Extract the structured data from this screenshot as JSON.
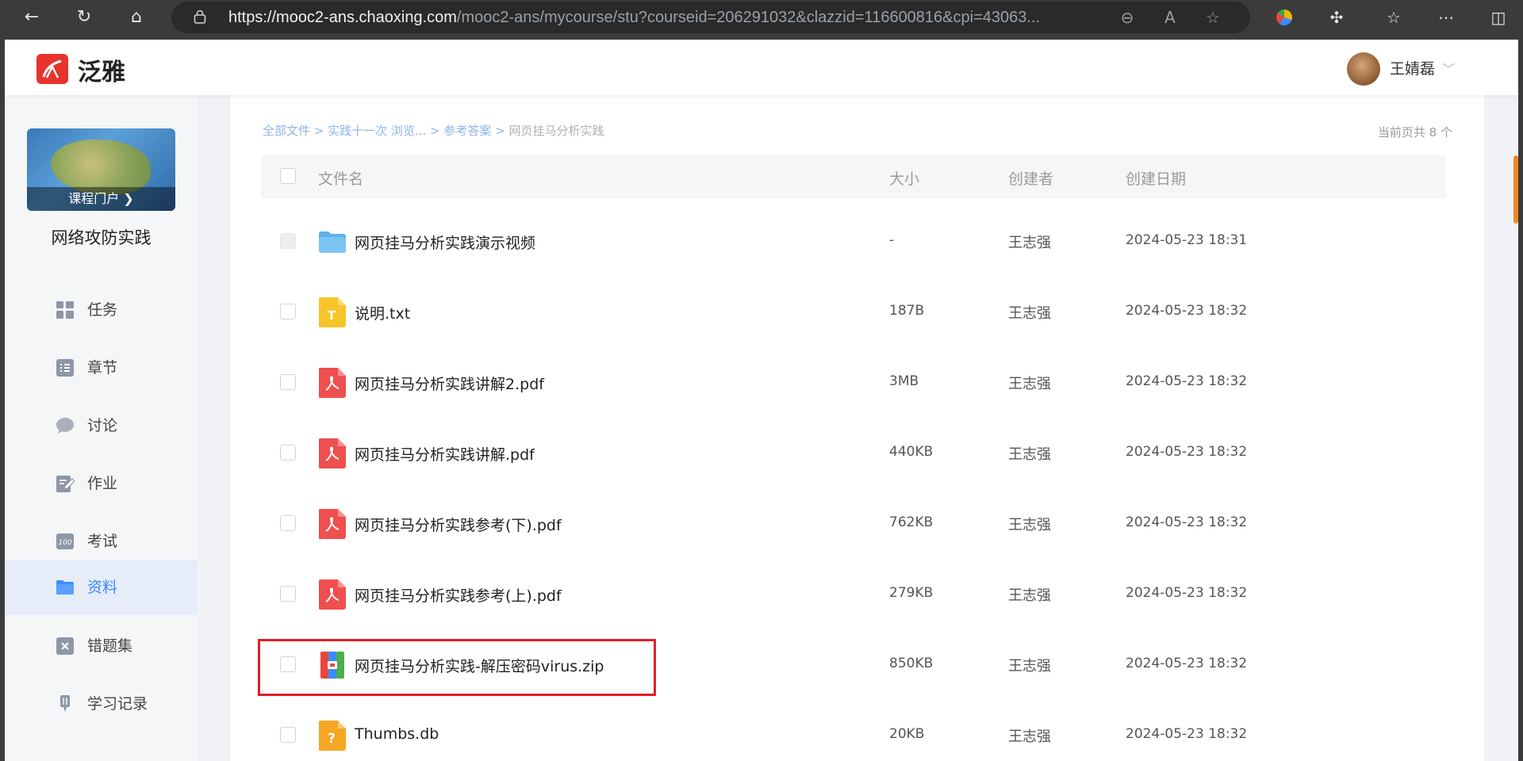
{
  "browser": {
    "url_host": "https://mooc2-ans.chaoxing.com",
    "url_path": "/mooc2-ans/mycourse/stu?courseid=206291032&clazzid=116600816&cpi=43063..."
  },
  "header": {
    "logo_text": "泛雅",
    "user_name": "王婧磊"
  },
  "sidebar": {
    "course_portal": "课程门户 ❯",
    "course_name": "网络攻防实践",
    "items": [
      {
        "label": "任务",
        "icon": "grid-icon"
      },
      {
        "label": "章节",
        "icon": "list-icon"
      },
      {
        "label": "讨论",
        "icon": "chat-bubble-icon"
      },
      {
        "label": "作业",
        "icon": "edit-doc-icon"
      },
      {
        "label": "考试",
        "icon": "exam-100-icon"
      },
      {
        "label": "资料",
        "icon": "folder-icon",
        "active": true
      },
      {
        "label": "错题集",
        "icon": "mistake-box-icon"
      },
      {
        "label": "学习记录",
        "icon": "record-pen-icon"
      }
    ]
  },
  "breadcrumb": [
    "全部文件",
    "实践十一次 浏览...",
    "参考答案",
    "网页挂马分析实践"
  ],
  "count_text": "当前页共 8 个",
  "table": {
    "headers": {
      "name": "文件名",
      "size": "大小",
      "creator": "创建者",
      "date": "创建日期"
    },
    "rows": [
      {
        "name": "网页挂马分析实践演示视频",
        "size": "-",
        "creator": "王志强",
        "date": "2024-05-23 18:31",
        "type": "folder"
      },
      {
        "name": "说明.txt",
        "size": "187B",
        "creator": "王志强",
        "date": "2024-05-23 18:32",
        "type": "txt"
      },
      {
        "name": "网页挂马分析实践讲解2.pdf",
        "size": "3MB",
        "creator": "王志强",
        "date": "2024-05-23 18:32",
        "type": "pdf"
      },
      {
        "name": "网页挂马分析实践讲解.pdf",
        "size": "440KB",
        "creator": "王志强",
        "date": "2024-05-23 18:32",
        "type": "pdf"
      },
      {
        "name": "网页挂马分析实践参考(下).pdf",
        "size": "762KB",
        "creator": "王志强",
        "date": "2024-05-23 18:32",
        "type": "pdf"
      },
      {
        "name": "网页挂马分析实践参考(上).pdf",
        "size": "279KB",
        "creator": "王志强",
        "date": "2024-05-23 18:32",
        "type": "pdf"
      },
      {
        "name": "网页挂马分析实践-解压密码virus.zip",
        "size": "850KB",
        "creator": "王志强",
        "date": "2024-05-23 18:32",
        "type": "zip"
      },
      {
        "name": "Thumbs.db",
        "size": "20KB",
        "creator": "王志强",
        "date": "2024-05-23 18:32",
        "type": "unknown"
      }
    ]
  },
  "colors": {
    "accent": "#3a8bff",
    "highlight_border": "#e01e26",
    "pdf_red": "#ef4f4f",
    "txt_yellow": "#f7c52b",
    "folder_blue": "#6ab8f0"
  }
}
